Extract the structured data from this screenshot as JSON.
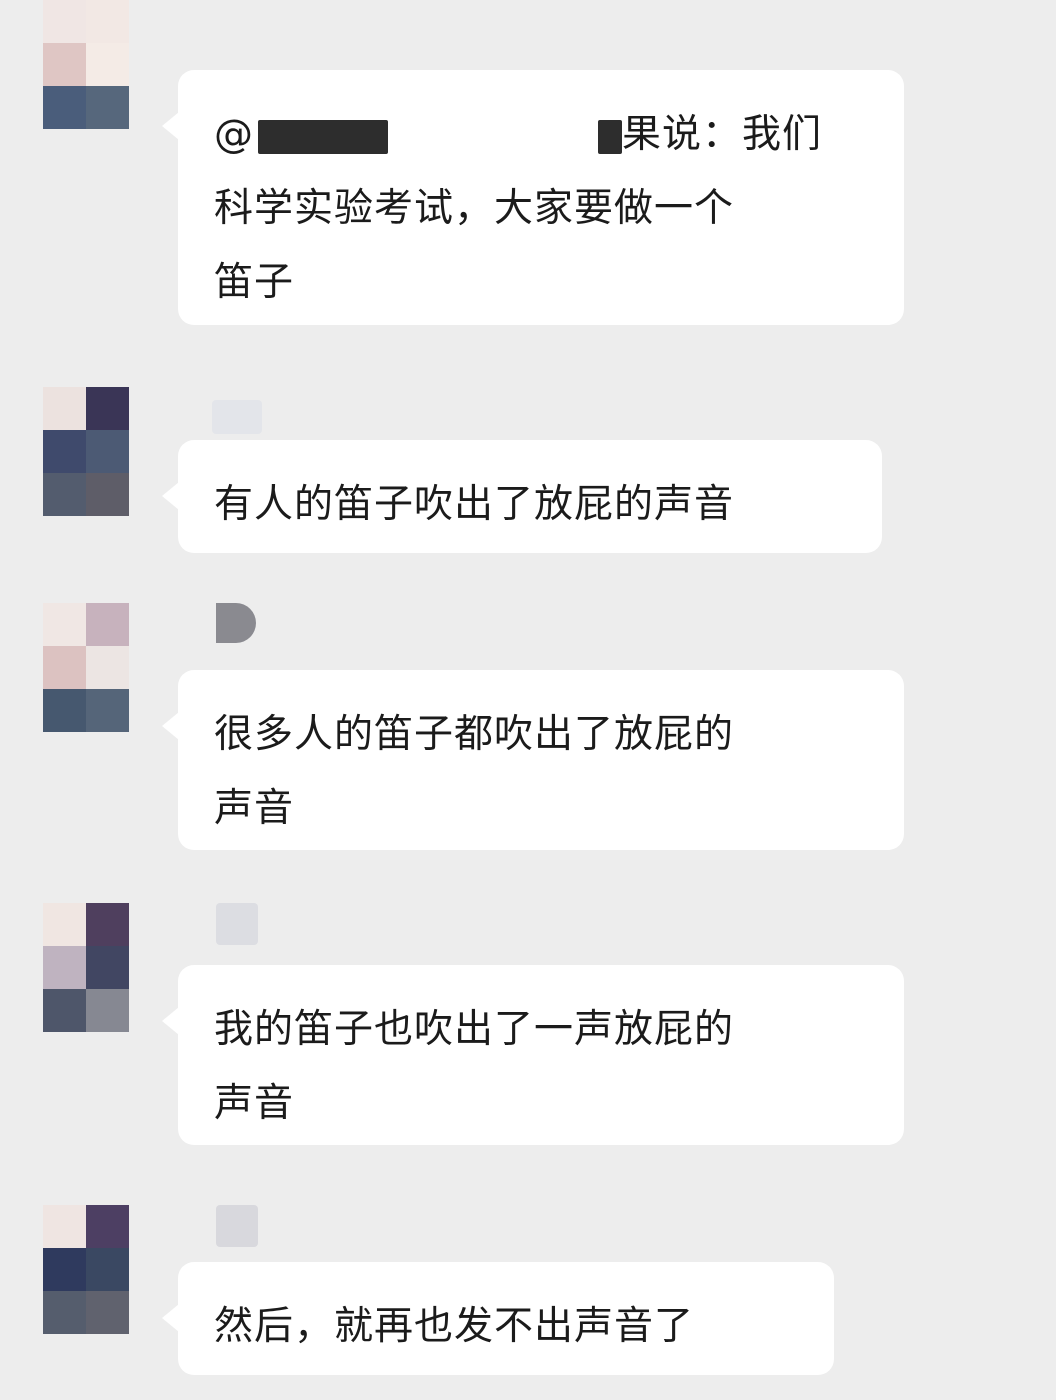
{
  "messages": [
    {
      "lines": [
        "@",
        "果说：我们",
        "科学实验考试，大家要做一个",
        "笛子"
      ]
    },
    {
      "lines": [
        "有人的笛子吹出了放屁的声音"
      ]
    },
    {
      "lines": [
        "很多人的笛子都吹出了放屁的",
        "声音"
      ]
    },
    {
      "lines": [
        "我的笛子也吹出了一声放屁的",
        "声音"
      ]
    },
    {
      "lines": [
        "然后，就再也发不出声音了"
      ]
    }
  ],
  "colors": {
    "background": "#ededed",
    "bubble": "#ffffff",
    "text": "#1b1b1b"
  }
}
